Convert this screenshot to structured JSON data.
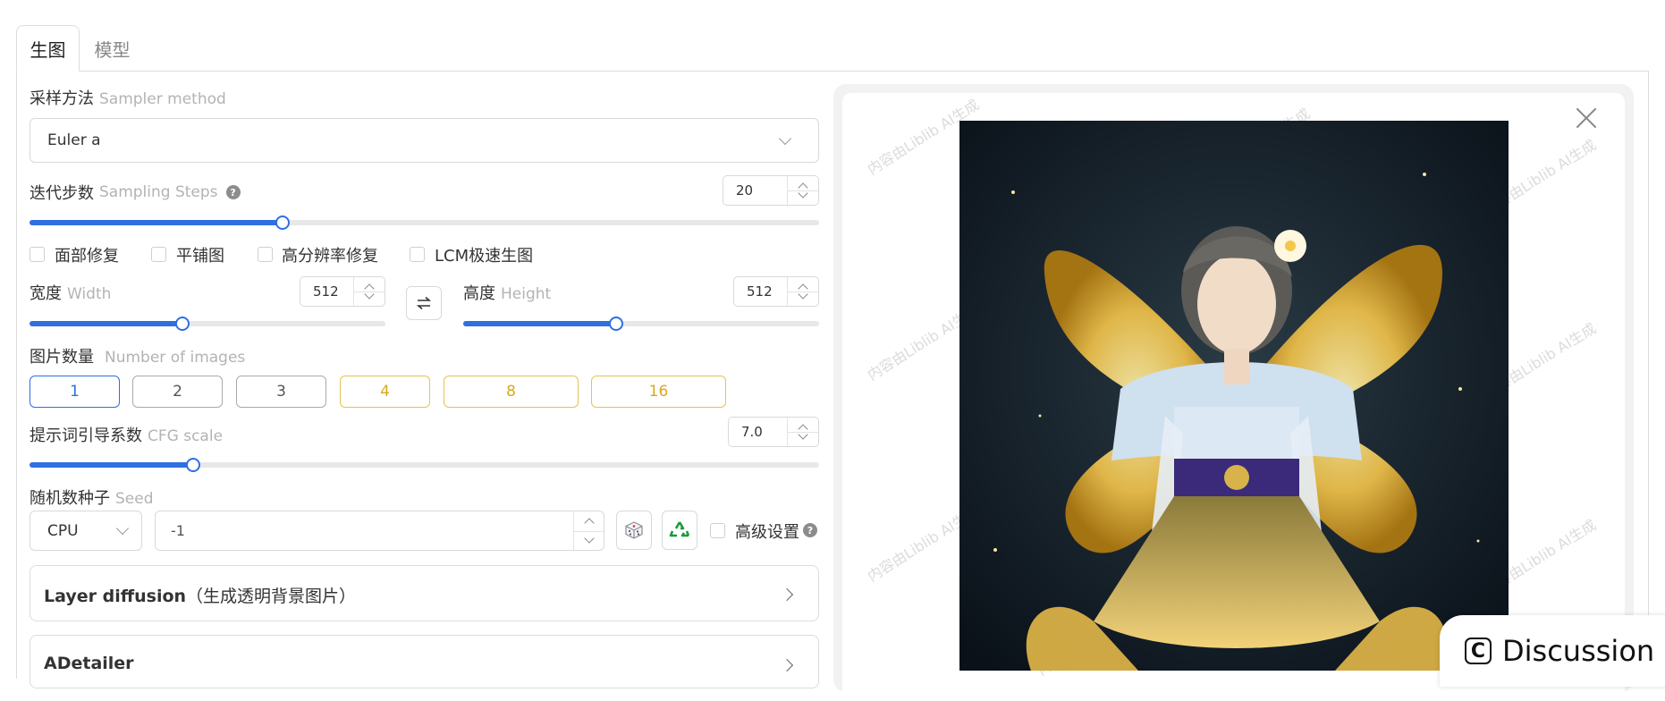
{
  "tabs": [
    {
      "label": "生图",
      "active": true
    },
    {
      "label": "模型",
      "active": false
    }
  ],
  "sampler": {
    "label_zh": "采样方法",
    "label_en": "Sampler method",
    "value": "Euler a"
  },
  "steps": {
    "label_zh": "迭代步数",
    "label_en": "Sampling Steps",
    "value": "20",
    "slider_fraction": 0.32
  },
  "checkboxes": [
    {
      "label": "面部修复",
      "checked": false
    },
    {
      "label": "平铺图",
      "checked": false
    },
    {
      "label": "高分辨率修复",
      "checked": false
    },
    {
      "label": "LCM极速生图",
      "checked": false
    }
  ],
  "width": {
    "label_zh": "宽度",
    "label_en": "Width",
    "value": "512",
    "slider_fraction": 0.43
  },
  "height": {
    "label_zh": "高度",
    "label_en": "Height",
    "value": "512",
    "slider_fraction": 0.43
  },
  "swap_icon": "swap-arrows-icon",
  "images": {
    "label_zh": "图片数量",
    "label_en": "Number of images",
    "options": [
      "1",
      "2",
      "3",
      "4",
      "8",
      "16"
    ],
    "selected": "1"
  },
  "cfg": {
    "label_zh": "提示词引导系数",
    "label_en": "CFG scale",
    "value": "7.0",
    "slider_fraction": 0.207
  },
  "seed": {
    "label_zh": "随机数种子",
    "label_en": "Seed",
    "device": "CPU",
    "value": "-1",
    "dice_icon": "dice-icon",
    "recycle_icon": "recycle-icon"
  },
  "advanced": {
    "label": "高级设置",
    "checked": false
  },
  "sections": [
    {
      "title_en": "Layer diffusion",
      "title_zh": "（生成透明背景图片）"
    },
    {
      "title_en": "ADetailer",
      "title_zh": ""
    }
  ],
  "watermark": "内容由Liblib AI生成",
  "discussion": {
    "label": "Discussion",
    "icon": "copyright-icon"
  },
  "colors": {
    "accent": "#2f6fe0",
    "gold": "#e7c34d",
    "border": "#d9d9d9"
  }
}
